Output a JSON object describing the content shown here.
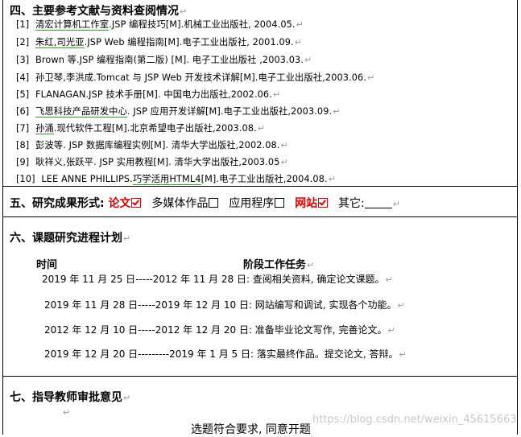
{
  "section4": {
    "title": "四、主要参考文献与资料查阅情况",
    "refs": [
      {
        "num": "[1]",
        "pre": "",
        "ul": "清宏计算机工作室",
        "post": ".JSP 编程技巧[M].机械工业出版社, 2004.05."
      },
      {
        "num": "[2]",
        "pre": "",
        "ul": "朱红,司光亚",
        "post": ".JSP Web 编程指南[M].电子工业出版社, 2001.09."
      },
      {
        "num": "[3]",
        "pre": "Brown 等.JSP 编程指南(第二版) [M]. 电子工业出版社 ,2003.03.",
        "ul": "",
        "post": ""
      },
      {
        "num": "[4]",
        "pre": "孙卫琴,李洪成.Tomcat 与 JSP Web 开发技术详解[M].电子工业出版社,2003.06.",
        "ul": "",
        "post": ""
      },
      {
        "num": "[5]",
        "pre": "FLANAGAN.JSP 技术手册[M]. 中国电力出版社,2002.06.",
        "ul": "",
        "post": ""
      },
      {
        "num": "[6]",
        "pre": "",
        "ul": "飞思科技产品研发中心",
        "post": ". JSP 应用开发详解[M].电子工业出版社,2003.09."
      },
      {
        "num": "[7]",
        "pre": "",
        "ul": "孙涌",
        "post": ".现代软件工程[M].北京希望电子出版社,2003.08."
      },
      {
        "num": "[8]",
        "pre": "彭波等. JSP 数据库编程实例[M]. 清华大学出版社,2002.08.",
        "ul": "",
        "post": ""
      },
      {
        "num": "[9]",
        "pre": "耿祥义,张跃平. JSP 实用教程[M]. 清华大学出版社,2003.05",
        "ul": "",
        "post": ""
      },
      {
        "num": "[10]",
        "pre": "  LEE ANNE PHILLIPS.",
        "ul": "巧学活用HTML4",
        "post": "[M].电子工业出版社,2004.08."
      }
    ]
  },
  "section5": {
    "title": "五、研究成果形式:",
    "thesis": "论文",
    "multimedia": "多媒体作品",
    "app": "应用程序",
    "website": "网站",
    "other": "其它:"
  },
  "section6": {
    "title": "六、课题研究进程计划",
    "col_time": "时间",
    "col_task": "阶段工作任务",
    "plans": [
      "2019 年 11 月 25 日-----2012 年 11 月 28 日: 查阅相关资料, 确定论文课题。",
      "2019 年 11 月 28 日-----2019 年 12 月 10 日: 网站编写和调试, 实现各个功能。",
      "2012 年 12 月 10 日-----2012 年 12 月 20 日: 准备毕业论文写作, 完善论文。",
      "2019 年 12 月 20 日---------2019 年 1 月 5 日: 落实最终作品。提交论文, 答辩。"
    ]
  },
  "section7": {
    "title": "七、指导教师审批意见",
    "opinion": "选题符合要求, 同意开题"
  },
  "paragraph_mark": "↵",
  "watermark": "https://blog.csdn.net/weixin_45615663"
}
